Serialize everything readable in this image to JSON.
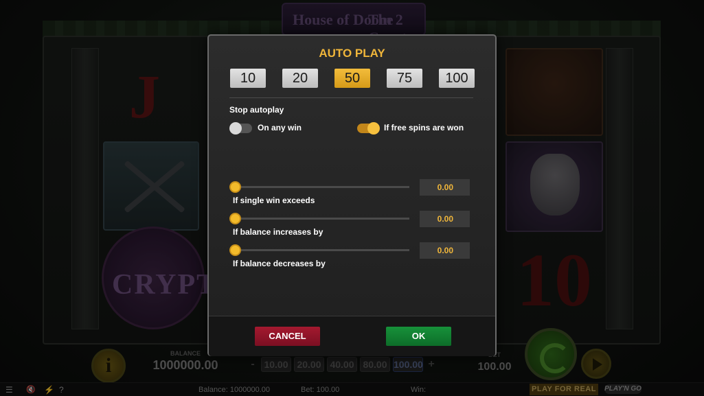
{
  "game": {
    "logo_text_1": "House of Doom 2",
    "logo_text_2": "The Crypt",
    "symbol_j": "J",
    "symbol_10": "10",
    "crypt_text": "CRYPT",
    "info_label": "i",
    "balance_label": "BALANCE",
    "balance_value": "1000000.00",
    "bet_minus": "-",
    "bet_plus": "+",
    "bet_options": [
      "10.00",
      "20.00",
      "40.00",
      "80.00",
      "100.00"
    ],
    "bet_selected": "100.00",
    "bet_label": "BET",
    "bet_value": "100.00"
  },
  "statusbar": {
    "menu_icon": "☰",
    "sound_icon": "🔇",
    "turbo_icon": "⚡",
    "help_icon": "?",
    "balance": "Balance: 1000000.00",
    "bet": "Bet: 100.00",
    "win": "Win:",
    "play_for_real": "PLAY FOR REAL",
    "provider_logo": "PLAY'N GO"
  },
  "modal": {
    "title": "AUTO PLAY",
    "counts": [
      {
        "label": "10",
        "active": false
      },
      {
        "label": "20",
        "active": false
      },
      {
        "label": "50",
        "active": true
      },
      {
        "label": "75",
        "active": false
      },
      {
        "label": "100",
        "active": false
      }
    ],
    "stop_autoplay_label": "Stop autoplay",
    "toggles": {
      "on_any_win": {
        "label": "On any win",
        "on": false
      },
      "free_spins_won": {
        "label": "If free spins are won",
        "on": true
      }
    },
    "sliders": [
      {
        "label": "If single win exceeds",
        "value": "0.00",
        "level": 0
      },
      {
        "label": "If balance increases by",
        "value": "0.00",
        "level": 0
      },
      {
        "label": "If balance decreases by",
        "value": "0.00",
        "level": 0
      }
    ],
    "cancel_label": "CANCEL",
    "ok_label": "OK"
  },
  "colors": {
    "accent_gold": "#f0b63a",
    "cancel_red": "#a4192f",
    "ok_green": "#17913a"
  }
}
